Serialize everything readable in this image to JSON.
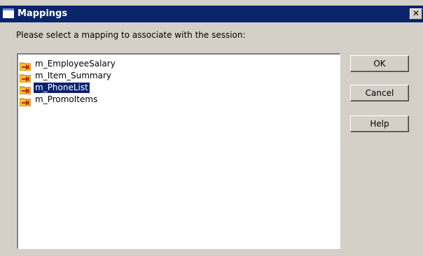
{
  "window": {
    "title": "Mappings",
    "close_glyph": "✕"
  },
  "prompt": "Please select a mapping to associate with the session:",
  "mappings": [
    {
      "label": "m_EmployeeSalary",
      "selected": false,
      "icon": "mapping-folder-icon"
    },
    {
      "label": "m_Item_Summary",
      "selected": false,
      "icon": "mapping-folder-icon"
    },
    {
      "label": "m_PhoneList",
      "selected": true,
      "icon": "mapping-folder-icon"
    },
    {
      "label": "m_PromoItems",
      "selected": false,
      "icon": "mapping-folder-icon"
    }
  ],
  "buttons": {
    "ok": "OK",
    "cancel": "Cancel",
    "help": "Help"
  },
  "colors": {
    "titlebar": "#0a246a",
    "selection": "#0a246a",
    "dialog_face": "#d4d0c8",
    "folder": "#f4c430",
    "arrow": "#d02020"
  }
}
